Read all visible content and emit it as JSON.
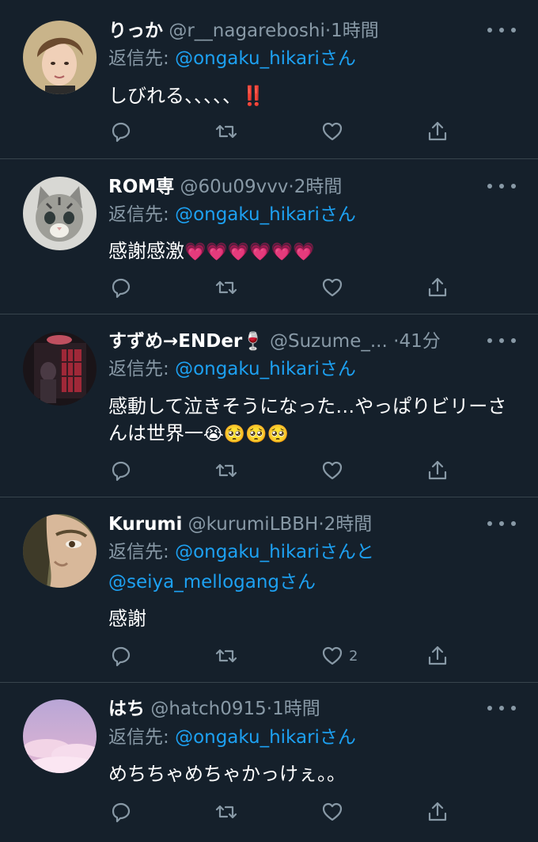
{
  "reply_prefix": "返信先: ",
  "tweets": [
    {
      "name": "りっか",
      "handle": "@r__nagareboshi",
      "separator": "·",
      "time": "1時間",
      "reply_to": [
        "@ongaku_hikari",
        "さん"
      ],
      "text": "しびれる、、、、、",
      "text_emoji": "‼️",
      "like_count": ""
    },
    {
      "name": "ROM専",
      "handle": "@60u09vvv",
      "separator": "·",
      "time": "2時間",
      "reply_to": [
        "@ongaku_hikari",
        "さん"
      ],
      "text": "感謝感激",
      "text_emoji": "💗💗💗💗💗💗",
      "like_count": ""
    },
    {
      "name": "すずめ→ENDer",
      "name_emoji": "🍷",
      "handle": "@Suzume_...",
      "separator": "·",
      "time": "41分",
      "reply_to": [
        "@ongaku_hikari",
        "さん"
      ],
      "text": "感動して泣きそうになった…やっぱりビリーさんは世界一",
      "text_emoji": "😭🥺🥺🥺",
      "like_count": ""
    },
    {
      "name": "Kurumi",
      "handle": "@kurumiLBBH",
      "separator": "·",
      "time": "2時間",
      "reply_to": [
        "@ongaku_hikari",
        "さんと",
        "@seiya_mellogang",
        "さん"
      ],
      "text": "感謝",
      "like_count": "2"
    },
    {
      "name": "はち",
      "handle": "@hatch0915",
      "separator": "·",
      "time": "1時間",
      "reply_to": [
        "@ongaku_hikari",
        "さん"
      ],
      "text": "めちちゃめちゃかっけぇ。。",
      "like_count": ""
    }
  ],
  "icons": {
    "reply": "speech-bubble-icon",
    "retweet": "retweet-arrows-icon",
    "like": "heart-outline-icon",
    "share": "share-upload-icon",
    "more": "three-dots-icon"
  },
  "colors": {
    "background": "#15202b",
    "divider": "#38444d",
    "secondary_text": "#8899a6",
    "link": "#1da1f2"
  }
}
